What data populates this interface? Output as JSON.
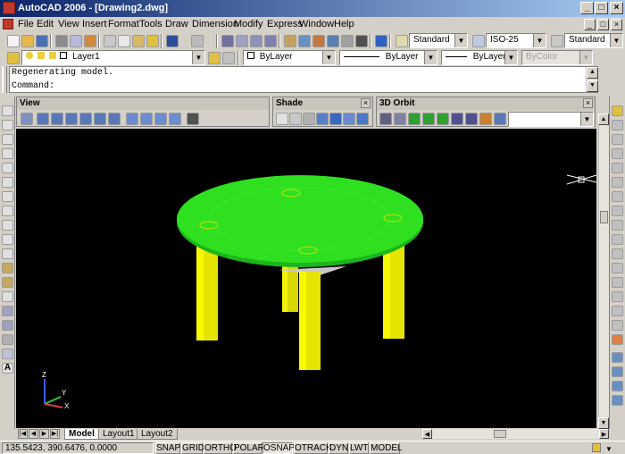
{
  "window": {
    "title": "AutoCAD 2006 - [Drawing2.dwg]",
    "min": "_",
    "max": "□",
    "close": "×"
  },
  "menu": [
    "File",
    "Edit",
    "View",
    "Insert",
    "Format",
    "Tools",
    "Draw",
    "Dimension",
    "Modify",
    "Express",
    "Window",
    "Help"
  ],
  "styles": {
    "text_style": "Standard",
    "dim_style": "ISO-25",
    "table_style": "Standard"
  },
  "layers": {
    "current": "Layer1",
    "color": "ByLayer",
    "linetype": "ByLayer",
    "lineweight": "ByLayer",
    "plotstyle": "ByColor"
  },
  "command": {
    "history": "Regenerating model.",
    "prompt": "Command:"
  },
  "panels": {
    "view": "View",
    "shade": "Shade",
    "orbit": "3D Orbit"
  },
  "tabs": [
    "Model",
    "Layout1",
    "Layout2"
  ],
  "status": {
    "coords": "135.5423, 390.6476, 0.0000",
    "toggles": [
      "SNAP",
      "GRID",
      "ORTHO",
      "POLAR",
      "OSNAP",
      "OTRACK",
      "DYN",
      "LWT",
      "MODEL"
    ]
  },
  "ucs": {
    "x": "X",
    "y": "Y",
    "z": "Z"
  },
  "colors": {
    "tabletop": "#2ee01f",
    "legs": "#f0f000",
    "viewport_bg": "#000000"
  }
}
